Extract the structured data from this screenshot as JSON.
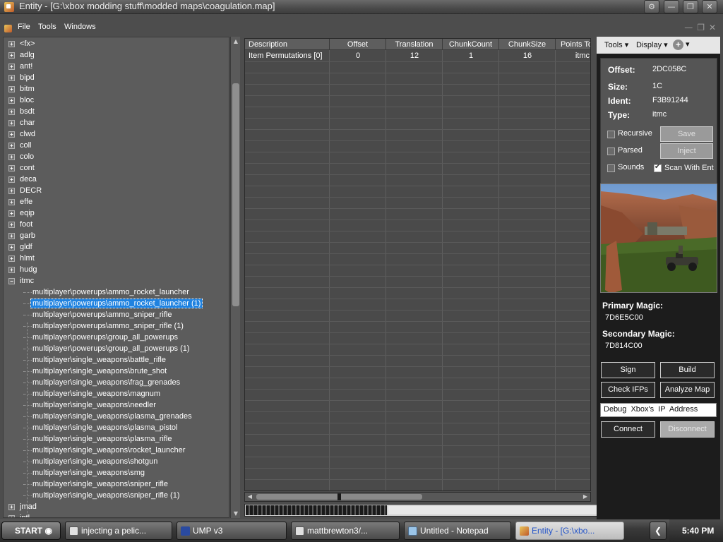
{
  "window": {
    "title": "Entity - [G:\\xbox modding stuff\\modded maps\\coagulation.map]"
  },
  "menu": {
    "items": [
      "File",
      "Tools",
      "Windows"
    ]
  },
  "tree": {
    "roots_before": [
      "<fx>",
      "adlg",
      "ant!",
      "bipd",
      "bitm",
      "bloc",
      "bsdt",
      "char",
      "clwd",
      "coll",
      "colo",
      "cont",
      "deca",
      "DECR",
      "effe",
      "eqip",
      "foot",
      "garb",
      "gldf",
      "hlmt",
      "hudg"
    ],
    "expanded": "itmc",
    "children": [
      "multiplayer\\powerups\\ammo_rocket_launcher",
      "multiplayer\\powerups\\ammo_rocket_launcher (1)",
      "multiplayer\\powerups\\ammo_sniper_rifle",
      "multiplayer\\powerups\\ammo_sniper_rifle (1)",
      "multiplayer\\powerups\\group_all_powerups",
      "multiplayer\\powerups\\group_all_powerups (1)",
      "multiplayer\\single_weapons\\battle_rifle",
      "multiplayer\\single_weapons\\brute_shot",
      "multiplayer\\single_weapons\\frag_grenades",
      "multiplayer\\single_weapons\\magnum",
      "multiplayer\\single_weapons\\needler",
      "multiplayer\\single_weapons\\plasma_grenades",
      "multiplayer\\single_weapons\\plasma_pistol",
      "multiplayer\\single_weapons\\plasma_rifle",
      "multiplayer\\single_weapons\\rocket_launcher",
      "multiplayer\\single_weapons\\shotgun",
      "multiplayer\\single_weapons\\smg",
      "multiplayer\\single_weapons\\sniper_rifle",
      "multiplayer\\single_weapons\\sniper_rifle (1)"
    ],
    "selected_child": 1,
    "roots_after": [
      "jmad",
      "jptl"
    ]
  },
  "grid": {
    "columns": [
      "Description",
      "Offset",
      "Translation",
      "ChunkCount",
      "ChunkSize",
      "Points To"
    ],
    "rows": [
      [
        "Item Permutations [0]",
        "0",
        "12",
        "1",
        "16",
        "itmc"
      ]
    ]
  },
  "right_toolbar": {
    "tools": "Tools",
    "display": "Display"
  },
  "info": {
    "offset_label": "Offset:",
    "offset": "2DC058C",
    "size_label": "Size:",
    "size": "1C",
    "ident_label": "Ident:",
    "ident": "F3B91244",
    "type_label": "Type:",
    "type": "itmc",
    "recursive": "Recursive",
    "parsed": "Parsed",
    "sounds": "Sounds",
    "scan_with_ent": "Scan With Ent",
    "scan_checked": true,
    "save": "Save",
    "inject": "Inject"
  },
  "magic": {
    "primary_label": "Primary Magic:",
    "primary": "7D6E5C00",
    "secondary_label": "Secondary Magic:",
    "secondary": "7D814C00"
  },
  "actions": {
    "sign": "Sign",
    "build": "Build",
    "check_ifps": "Check IFPs",
    "analyze_map": "Analyze Map",
    "ip_field": "Debug Xbox's IP Address",
    "connect": "Connect",
    "disconnect": "Disconnect"
  },
  "taskbar": {
    "start": "START",
    "tasks": [
      "injecting a pelic...",
      "UMP v3",
      "mattbrewton3/...",
      "Untitled - Notepad",
      "Entity - [G:\\xbo..."
    ],
    "clock": "5:40 PM"
  },
  "colors": {
    "selection": "#1f82e0",
    "active_task_text": "#2656c8"
  }
}
